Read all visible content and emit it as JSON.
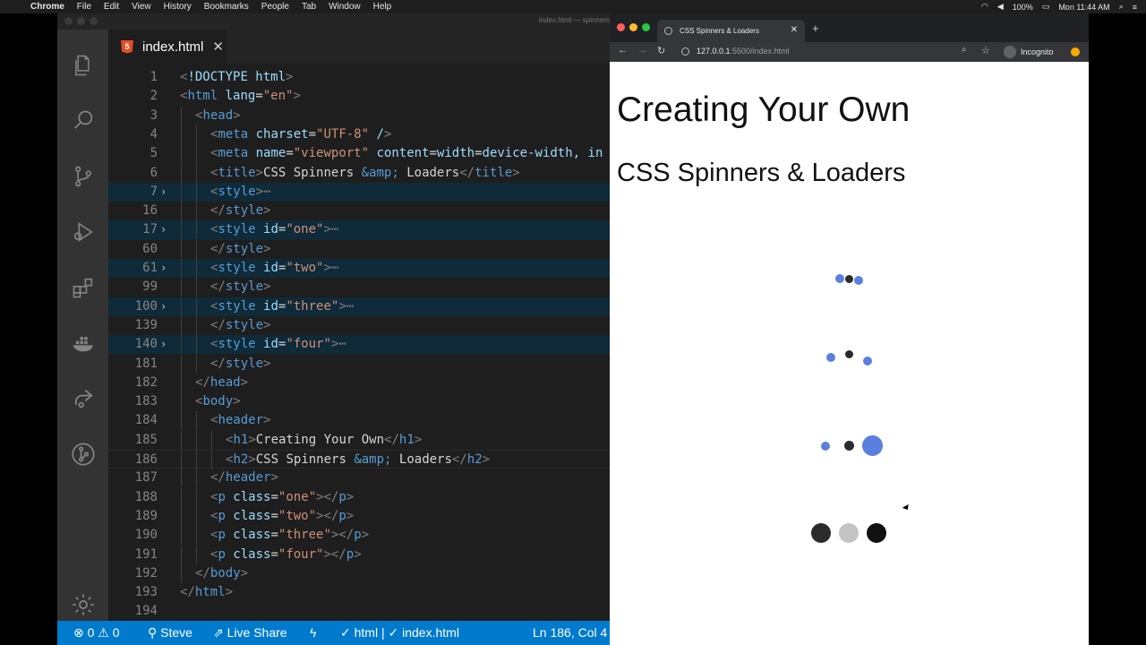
{
  "menubar": {
    "app": "Chrome",
    "items": [
      "File",
      "Edit",
      "View",
      "History",
      "Bookmarks",
      "People",
      "Tab",
      "Window",
      "Help"
    ],
    "battery": "100%",
    "clock": "Mon 11:44 AM"
  },
  "vscode": {
    "window_title": "index.html — spinners",
    "tab": {
      "label": "index.html",
      "close_glyph": "✕"
    },
    "activity_icons": [
      "explorer-icon",
      "search-icon",
      "source-control-icon",
      "debug-icon",
      "extensions-icon",
      "docker-icon",
      "live-share-icon",
      "git-graph-icon",
      "settings-gear-icon"
    ],
    "lines": [
      {
        "n": "1",
        "fold": "",
        "indent": 0,
        "code": "<!DOCTYPE html>"
      },
      {
        "n": "2",
        "fold": "",
        "indent": 0,
        "code": "<html lang=\"en\">"
      },
      {
        "n": "3",
        "fold": "",
        "indent": 1,
        "code": "<head>"
      },
      {
        "n": "4",
        "fold": "",
        "indent": 2,
        "code": "<meta charset=\"UTF-8\" />"
      },
      {
        "n": "5",
        "fold": "",
        "indent": 2,
        "code": "<meta name=\"viewport\" content=\"width=device-width, in"
      },
      {
        "n": "6",
        "fold": "",
        "indent": 2,
        "code": "<title>CSS Spinners &amp; Loaders</title>"
      },
      {
        "n": "7",
        "fold": "›",
        "indent": 2,
        "code": "<style>⋯",
        "hl": true
      },
      {
        "n": "16",
        "fold": "",
        "indent": 2,
        "code": "</style>"
      },
      {
        "n": "17",
        "fold": "›",
        "indent": 2,
        "code": "<style id=\"one\">⋯",
        "hl": true
      },
      {
        "n": "60",
        "fold": "",
        "indent": 2,
        "code": "</style>"
      },
      {
        "n": "61",
        "fold": "›",
        "indent": 2,
        "code": "<style id=\"two\">⋯",
        "hl": true
      },
      {
        "n": "99",
        "fold": "",
        "indent": 2,
        "code": "</style>"
      },
      {
        "n": "100",
        "fold": "›",
        "indent": 2,
        "code": "<style id=\"three\">⋯",
        "hl": true
      },
      {
        "n": "139",
        "fold": "",
        "indent": 2,
        "code": "</style>"
      },
      {
        "n": "140",
        "fold": "›",
        "indent": 2,
        "code": "<style id=\"four\">⋯",
        "hl": true
      },
      {
        "n": "181",
        "fold": "",
        "indent": 2,
        "code": "</style>"
      },
      {
        "n": "182",
        "fold": "",
        "indent": 1,
        "code": "</head>"
      },
      {
        "n": "183",
        "fold": "",
        "indent": 1,
        "code": "<body>"
      },
      {
        "n": "184",
        "fold": "",
        "indent": 2,
        "code": "<header>"
      },
      {
        "n": "185",
        "fold": "",
        "indent": 3,
        "code": "<h1>Creating Your Own</h1>"
      },
      {
        "n": "186",
        "fold": "",
        "indent": 3,
        "code": "<h2>CSS Spinners &amp; Loaders</h2>",
        "cur": true
      },
      {
        "n": "187",
        "fold": "",
        "indent": 2,
        "code": "</header>"
      },
      {
        "n": "188",
        "fold": "",
        "indent": 2,
        "code": "<p class=\"one\"></p>"
      },
      {
        "n": "189",
        "fold": "",
        "indent": 2,
        "code": "<p class=\"two\"></p>"
      },
      {
        "n": "190",
        "fold": "",
        "indent": 2,
        "code": "<p class=\"three\"></p>"
      },
      {
        "n": "191",
        "fold": "",
        "indent": 2,
        "code": "<p class=\"four\"></p>"
      },
      {
        "n": "192",
        "fold": "",
        "indent": 1,
        "code": "</body>"
      },
      {
        "n": "193",
        "fold": "",
        "indent": 0,
        "code": "</html>"
      },
      {
        "n": "194",
        "fold": "",
        "indent": 0,
        "code": ""
      }
    ],
    "status": {
      "errors": "0",
      "warnings": "0",
      "user": "Steve",
      "live_share": "Live Share",
      "language": "html",
      "file": "index.html",
      "position": "Ln 186, Col 4"
    }
  },
  "chrome": {
    "tab_title": "CSS Spinners & Loaders",
    "url_host": "127.0.0.1",
    "url_rest": ":5500/index.html",
    "profile": "Incognito",
    "page": {
      "h1": "Creating Your Own",
      "h2": "CSS Spinners & Loaders"
    },
    "colors": {
      "blue": "#5b7fe0",
      "dark": "#2b2b2b",
      "gray": "#c4c4c4",
      "black": "#111111"
    }
  }
}
